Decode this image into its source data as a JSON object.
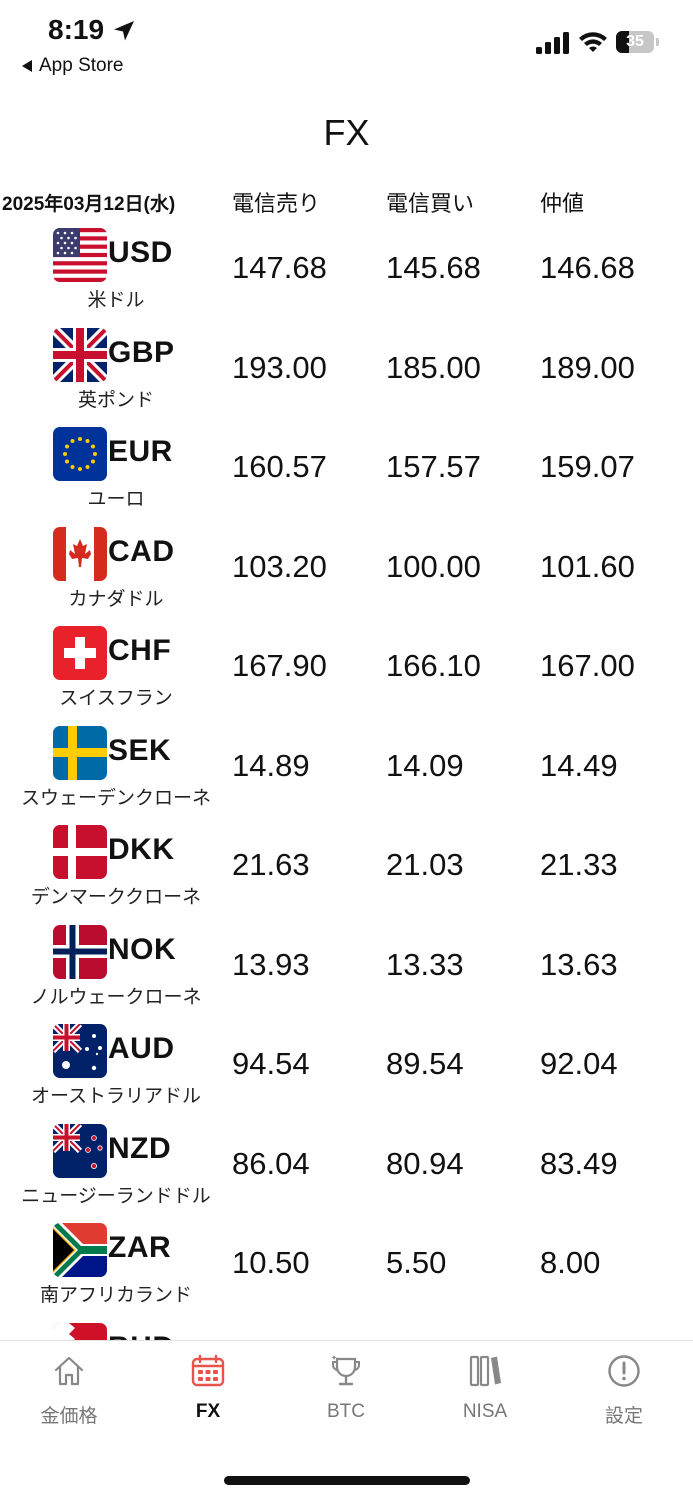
{
  "status_bar": {
    "time": "8:19",
    "back_label": "App Store",
    "battery_level": "35",
    "battery_fraction": 0.35
  },
  "page": {
    "title": "FX"
  },
  "table": {
    "date": "2025年03月12日(水)",
    "columns": [
      "電信売り",
      "電信買い",
      "仲値"
    ],
    "rows": [
      {
        "code": "USD",
        "name": "米ドル",
        "flag": "usa-flag-icon",
        "tts": "147.68",
        "ttb": "145.68",
        "mid": "146.68"
      },
      {
        "code": "GBP",
        "name": "英ポンド",
        "flag": "uk-flag-icon",
        "tts": "193.00",
        "ttb": "185.00",
        "mid": "189.00"
      },
      {
        "code": "EUR",
        "name": "ユーロ",
        "flag": "eu-flag-icon",
        "tts": "160.57",
        "ttb": "157.57",
        "mid": "159.07"
      },
      {
        "code": "CAD",
        "name": "カナダドル",
        "flag": "canada-flag-icon",
        "tts": "103.20",
        "ttb": "100.00",
        "mid": "101.60"
      },
      {
        "code": "CHF",
        "name": "スイスフラン",
        "flag": "switzerland-flag-icon",
        "tts": "167.90",
        "ttb": "166.10",
        "mid": "167.00"
      },
      {
        "code": "SEK",
        "name": "スウェーデンクローネ",
        "flag": "sweden-flag-icon",
        "tts": "14.89",
        "ttb": "14.09",
        "mid": "14.49"
      },
      {
        "code": "DKK",
        "name": "デンマーククローネ",
        "flag": "denmark-flag-icon",
        "tts": "21.63",
        "ttb": "21.03",
        "mid": "21.33"
      },
      {
        "code": "NOK",
        "name": "ノルウェークローネ",
        "flag": "norway-flag-icon",
        "tts": "13.93",
        "ttb": "13.33",
        "mid": "13.63"
      },
      {
        "code": "AUD",
        "name": "オーストラリアドル",
        "flag": "australia-flag-icon",
        "tts": "94.54",
        "ttb": "89.54",
        "mid": "92.04"
      },
      {
        "code": "NZD",
        "name": "ニュージーランドドル",
        "flag": "new-zealand-flag-icon",
        "tts": "86.04",
        "ttb": "80.94",
        "mid": "83.49"
      },
      {
        "code": "ZAR",
        "name": "南アフリカランド",
        "flag": "south-africa-flag-icon",
        "tts": "10.50",
        "ttb": "5.50",
        "mid": "8.00"
      },
      {
        "code": "BHD",
        "name": "",
        "flag": "bahrain-flag-icon",
        "tts": "",
        "ttb": "",
        "mid": ""
      }
    ]
  },
  "tab_bar": {
    "active_index": 1,
    "tabs": [
      {
        "label": "金価格",
        "icon": "home-icon"
      },
      {
        "label": "FX",
        "icon": "calendar-icon"
      },
      {
        "label": "BTC",
        "icon": "trophy-icon"
      },
      {
        "label": "NISA",
        "icon": "books-icon"
      },
      {
        "label": "設定",
        "icon": "info-circle-icon"
      }
    ]
  },
  "colors": {
    "accent": "#e8544b",
    "text": "#111111",
    "inactive": "#777777",
    "divider": "#e2e2e2"
  }
}
